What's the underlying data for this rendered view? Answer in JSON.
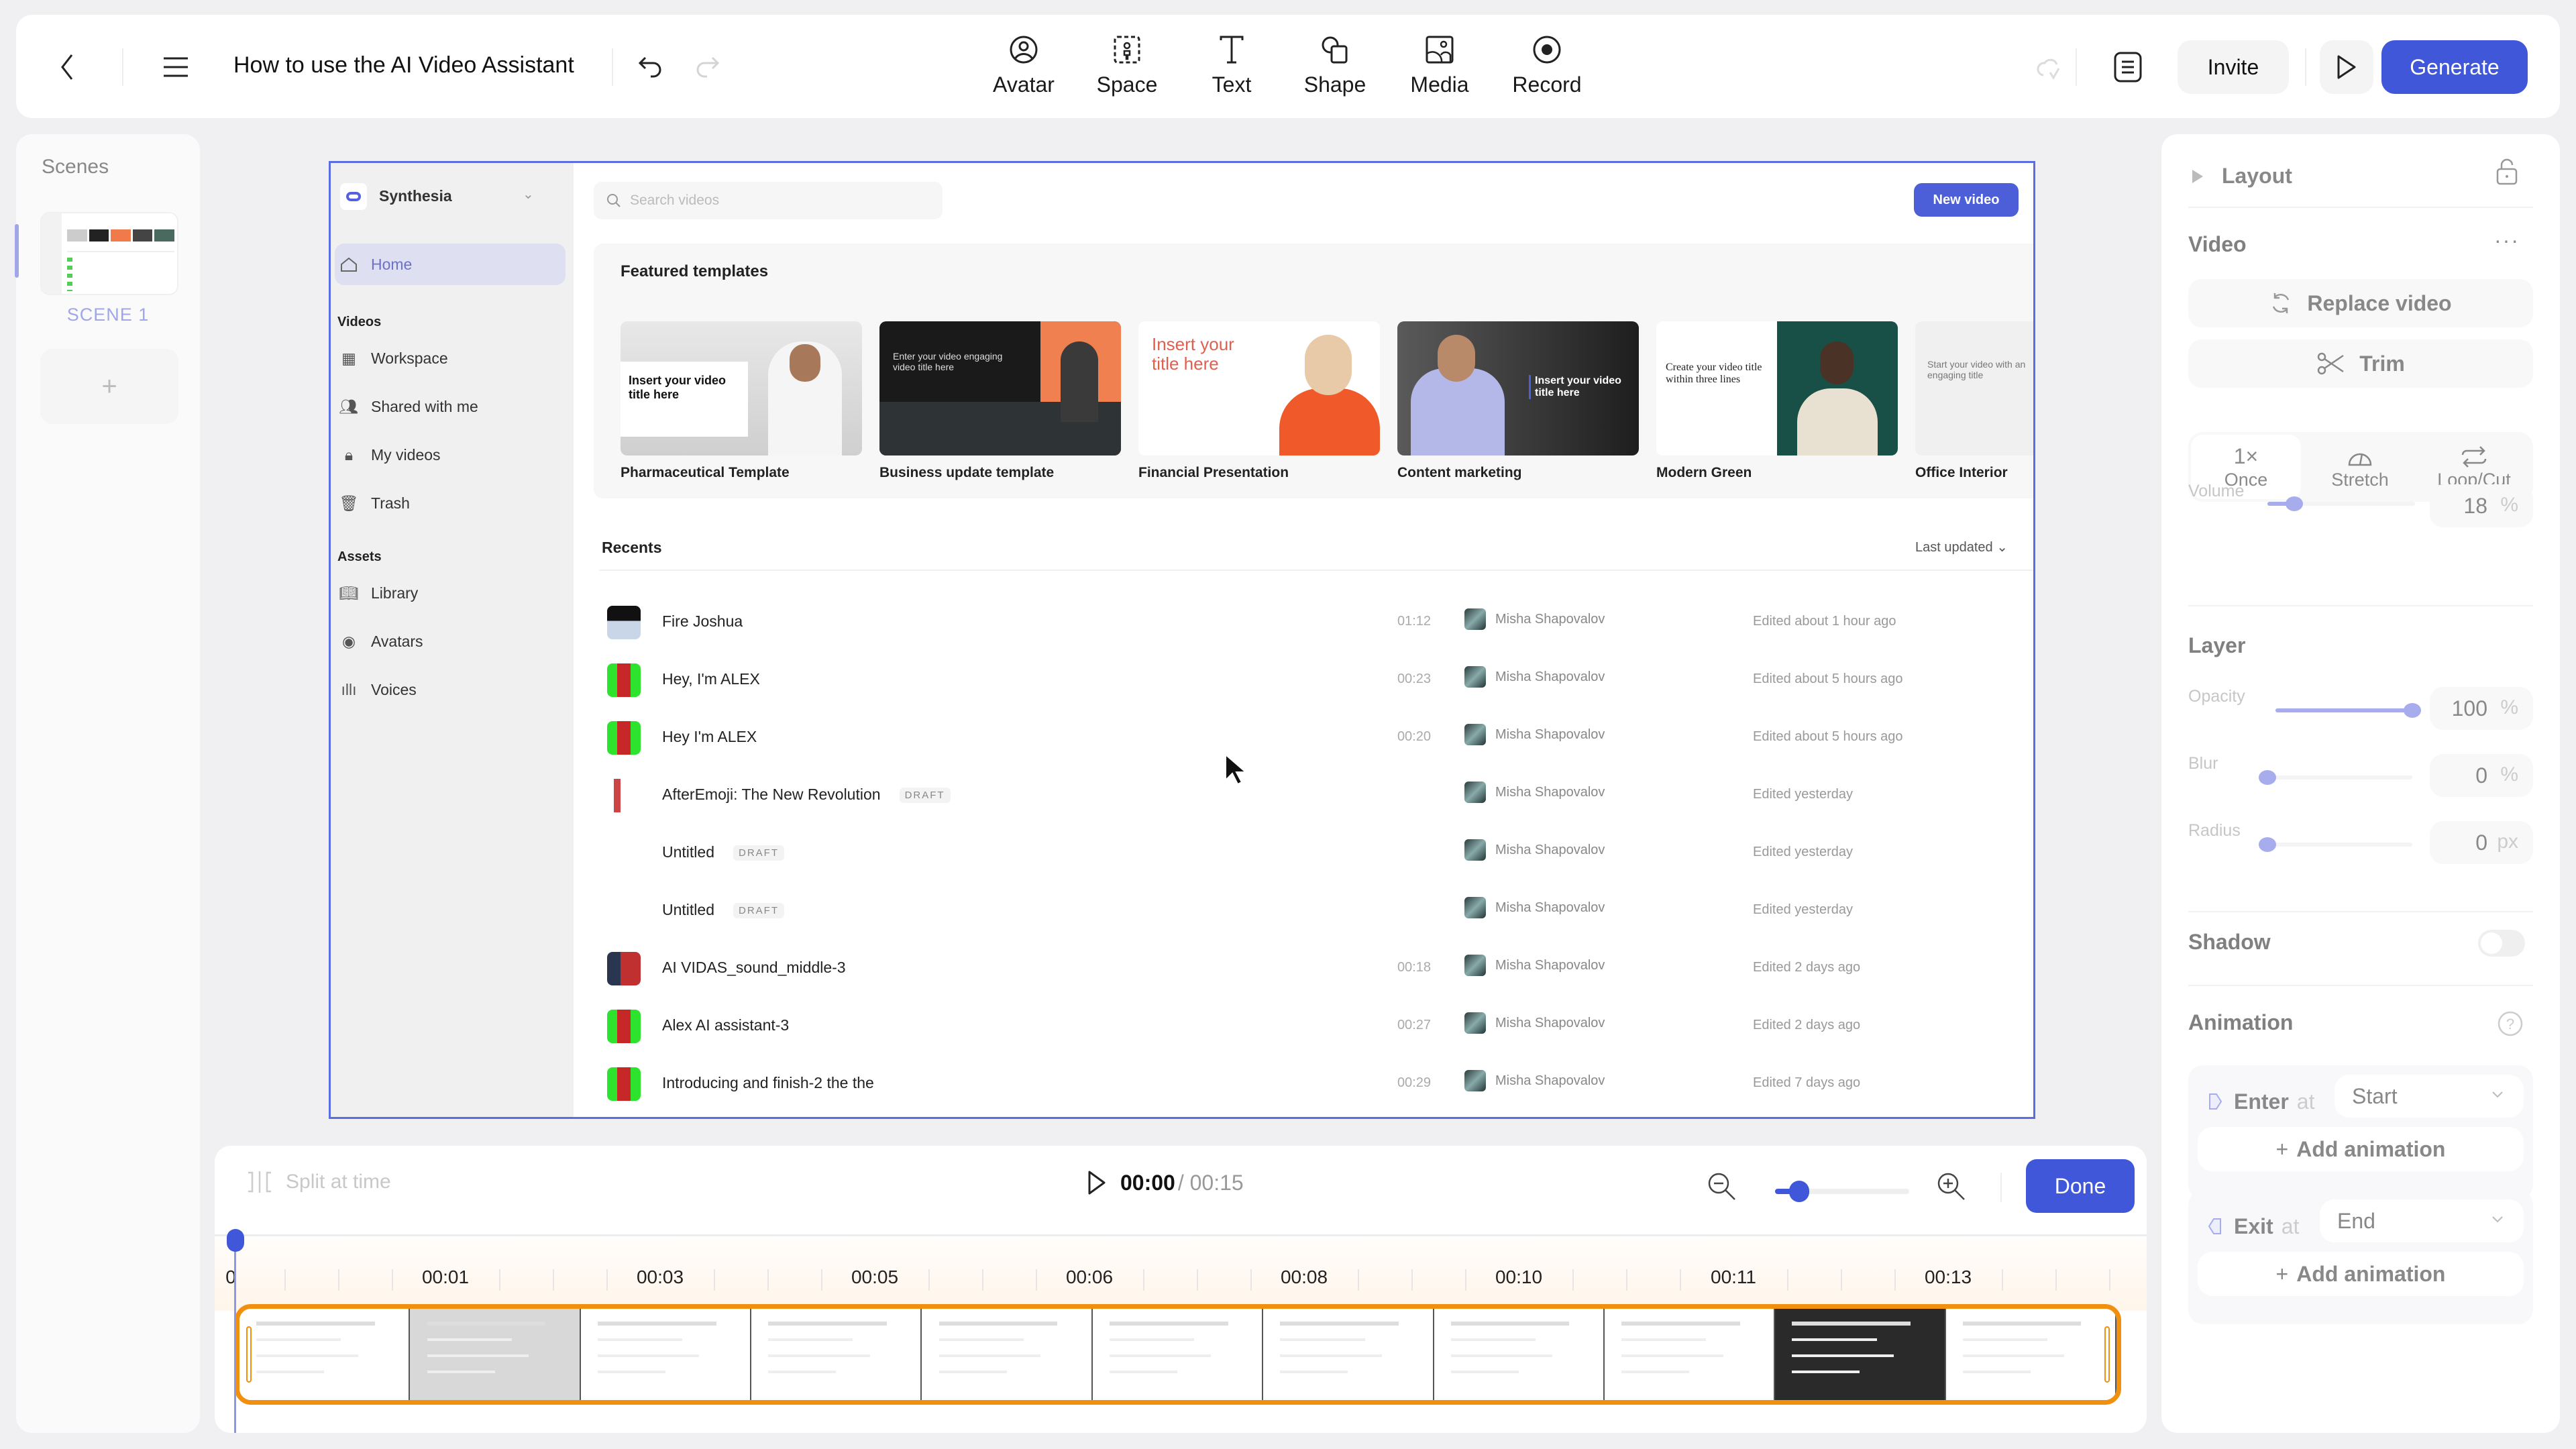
{
  "topbar": {
    "back_icon": "chevron-left-icon",
    "menu_icon": "hamburger-menu-icon",
    "title": "How to use the AI Video Assistant",
    "undo_icon": "undo-icon",
    "redo_icon": "redo-icon",
    "tools": [
      {
        "label": "Avatar",
        "icon": "avatar-icon"
      },
      {
        "label": "Space",
        "icon": "space-icon"
      },
      {
        "label": "Text",
        "icon": "text-icon"
      },
      {
        "label": "Shape",
        "icon": "shape-icon"
      },
      {
        "label": "Media",
        "icon": "media-icon"
      },
      {
        "label": "Record",
        "icon": "record-icon"
      }
    ],
    "cloud_icon": "cloud-saved-icon",
    "notes_icon": "script-notes-icon",
    "invite_label": "Invite",
    "preview_icon": "play-preview-icon",
    "generate_label": "Generate",
    "accent_color": "#3f57d8"
  },
  "scenes": {
    "title": "Scenes",
    "items": [
      {
        "label": "SCENE 1",
        "selected": true
      }
    ],
    "add_label": "+"
  },
  "canvas": {
    "app": {
      "brand": "Synthesia",
      "nav": {
        "home": "Home",
        "videos_header": "Videos",
        "videos": [
          "Workspace",
          "Shared with me",
          "My videos",
          "Trash"
        ],
        "assets_header": "Assets",
        "assets": [
          "Library",
          "Avatars",
          "Voices"
        ]
      },
      "search_placeholder": "Search videos",
      "new_video_label": "New video",
      "featured_title": "Featured templates",
      "templates": [
        {
          "name": "Pharmaceutical Template",
          "thumb_text": "Insert your video title here"
        },
        {
          "name": "Business update template",
          "thumb_text": "Enter your video engaging video title here"
        },
        {
          "name": "Financial Presentation",
          "thumb_text": "Insert your title here"
        },
        {
          "name": "Content marketing",
          "thumb_text": "Insert your video title here"
        },
        {
          "name": "Modern Green",
          "thumb_text": "Create your video title within three lines"
        },
        {
          "name": "Office Interior",
          "thumb_text": "Start your video with an engaging title"
        }
      ],
      "recents_title": "Recents",
      "sort_label": "Last updated",
      "recents": [
        {
          "name": "Fire Joshua",
          "draft": false,
          "duration": "01:12",
          "owner": "Misha Shapovalov",
          "edited": "Edited about 1 hour ago",
          "thumb": "dark"
        },
        {
          "name": "Hey, I'm ALEX",
          "draft": false,
          "duration": "00:23",
          "owner": "Misha Shapovalov",
          "edited": "Edited about 5 hours ago",
          "thumb": "green"
        },
        {
          "name": "Hey I'm ALEX",
          "draft": false,
          "duration": "00:20",
          "owner": "Misha Shapovalov",
          "edited": "Edited about 5 hours ago",
          "thumb": "green"
        },
        {
          "name": "AfterEmoji: The New Revolution",
          "draft": true,
          "duration": "",
          "owner": "Misha Shapovalov",
          "edited": "Edited yesterday",
          "thumb": "white"
        },
        {
          "name": "Untitled",
          "draft": true,
          "duration": "",
          "owner": "Misha Shapovalov",
          "edited": "Edited yesterday",
          "thumb": "none"
        },
        {
          "name": "Untitled",
          "draft": true,
          "duration": "",
          "owner": "Misha Shapovalov",
          "edited": "Edited yesterday",
          "thumb": "none"
        },
        {
          "name": "AI VIDAS_sound_middle-3",
          "draft": false,
          "duration": "00:18",
          "owner": "Misha Shapovalov",
          "edited": "Edited 2 days ago",
          "thumb": "navy"
        },
        {
          "name": "Alex AI assistant-3",
          "draft": false,
          "duration": "00:27",
          "owner": "Misha Shapovalov",
          "edited": "Edited 2 days ago",
          "thumb": "green"
        },
        {
          "name": "Introducing and finish-2 the the",
          "draft": false,
          "duration": "00:29",
          "owner": "Misha Shapovalov",
          "edited": "Edited 7 days ago",
          "thumb": "green"
        }
      ],
      "draft_label": "DRAFT"
    }
  },
  "properties": {
    "layout_label": "Layout",
    "video_label": "Video",
    "replace_label": "Replace video",
    "trim_label": "Trim",
    "modes": [
      {
        "label": "Once",
        "glyph": "1×",
        "selected": true
      },
      {
        "label": "Stretch",
        "glyph": "",
        "selected": false
      },
      {
        "label": "Loop/Cut",
        "glyph": "",
        "selected": false
      }
    ],
    "volume": {
      "label": "Volume",
      "value": "18",
      "unit": "%",
      "fraction": 0.18
    },
    "layer_label": "Layer",
    "opacity": {
      "label": "Opacity",
      "value": "100",
      "unit": "%",
      "fraction": 1.0
    },
    "blur": {
      "label": "Blur",
      "value": "0",
      "unit": "%",
      "fraction": 0
    },
    "radius": {
      "label": "Radius",
      "value": "0",
      "unit": "px",
      "fraction": 0
    },
    "shadow_label": "Shadow",
    "shadow_on": false,
    "animation_label": "Animation",
    "enter": {
      "label": "Enter",
      "at": "at",
      "value": "Start",
      "add_label": "Add animation"
    },
    "exit": {
      "label": "Exit",
      "at": "at",
      "value": "End",
      "add_label": "Add animation"
    },
    "slider_color": "#a7acec"
  },
  "timeline": {
    "split_label": "Split at time",
    "current_time": "00:00",
    "total_time": "/ 00:15",
    "zoom_fraction": 0.18,
    "done_label": "Done",
    "ruler_labels": [
      "0",
      "00:01",
      "00:03",
      "00:05",
      "00:06",
      "00:08",
      "00:10",
      "00:11",
      "00:13"
    ],
    "clip_color": "#f18f0f",
    "frame_count": 11
  }
}
